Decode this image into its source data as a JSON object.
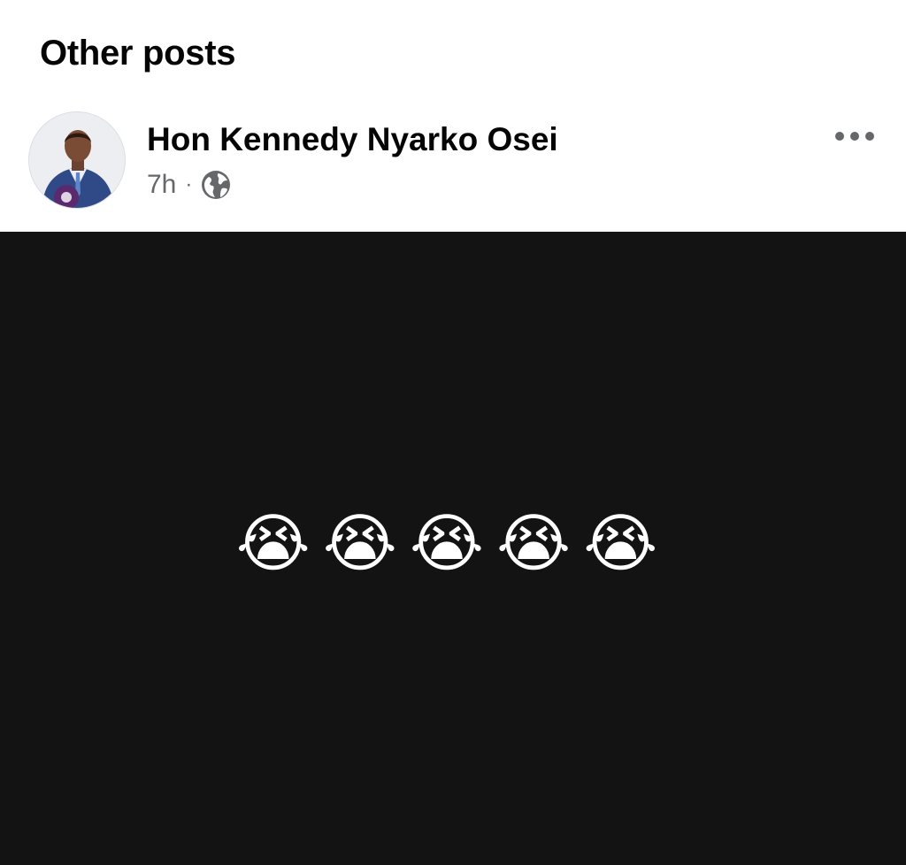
{
  "section": {
    "title": "Other posts"
  },
  "post": {
    "author": "Hon Kennedy Nyarko Osei",
    "time": "7h",
    "separator": "·",
    "audience_icon": "globe-icon",
    "more_icon": "more-horizontal-icon",
    "body_text": "😭😭😭😭😭",
    "body_background": "#131313"
  }
}
